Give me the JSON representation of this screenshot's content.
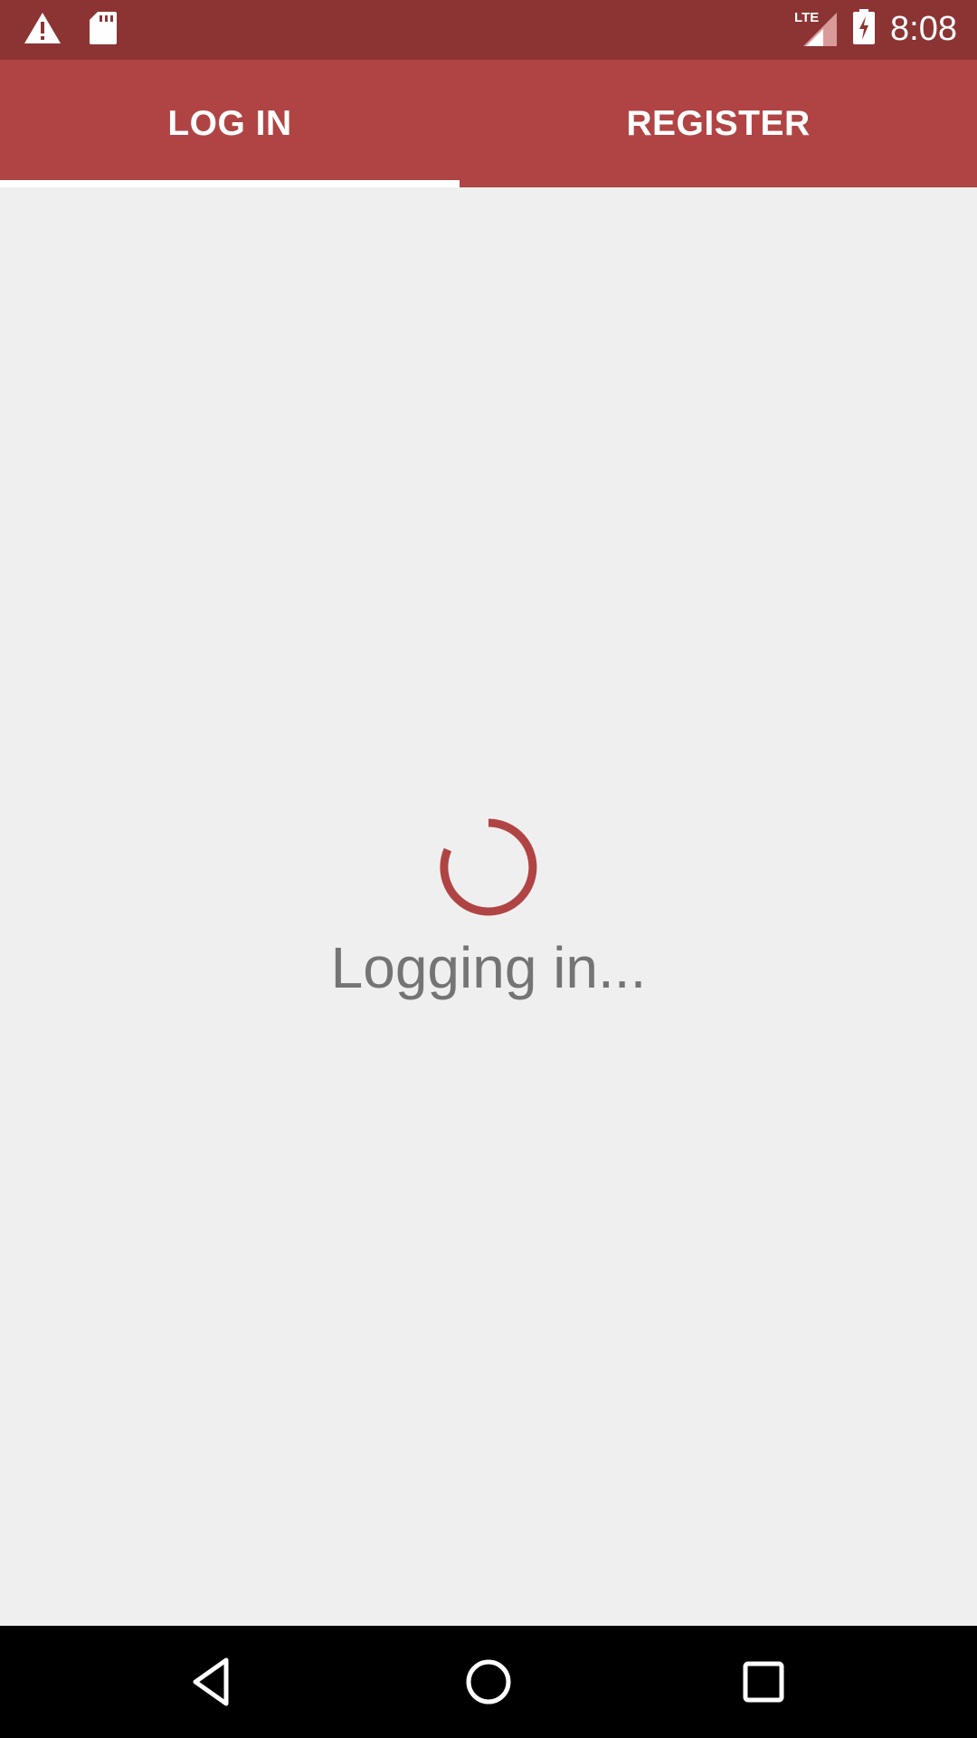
{
  "status_bar": {
    "time": "8:08",
    "network": "LTE",
    "icons": [
      "warning-icon",
      "sd-card-icon",
      "lte-signal-icon",
      "battery-charging-icon"
    ]
  },
  "tabs": [
    {
      "label": "LOG IN",
      "selected": true
    },
    {
      "label": "REGISTER",
      "selected": false
    }
  ],
  "main": {
    "loading_text": "Logging in..."
  },
  "nav_bar": {
    "icons": [
      "back-icon",
      "home-icon",
      "recents-icon"
    ]
  },
  "colors": {
    "status_bar": "#8c3434",
    "tab_bar": "#b04444",
    "accent": "#b04444",
    "background": "#f0eff0",
    "loading_text": "#747474"
  }
}
